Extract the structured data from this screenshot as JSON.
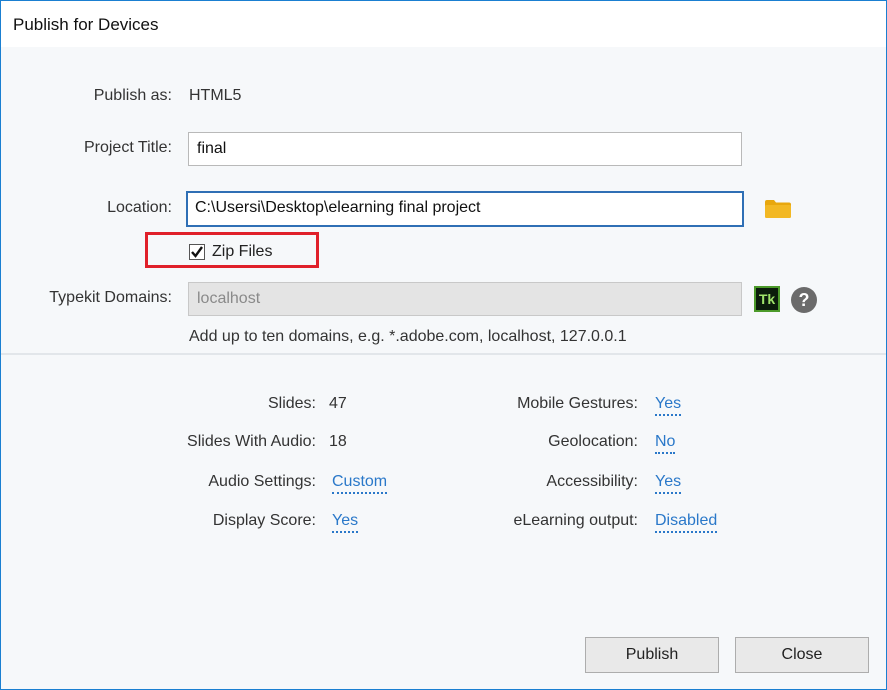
{
  "window": {
    "title": "Publish for Devices"
  },
  "publish_as": {
    "label": "Publish as:",
    "value": "HTML5"
  },
  "project_title": {
    "label": "Project Title:",
    "value": "final"
  },
  "location": {
    "label": "Location:",
    "value": "C:\\Usersi\\Desktop\\elearning final project",
    "folder_icon": "folder-icon"
  },
  "zip_files": {
    "label": "Zip Files",
    "checked": true
  },
  "typekit": {
    "label": "Typekit Domains:",
    "placeholder": "localhost",
    "tk_label": "Tk",
    "help_label": "?",
    "hint": "Add up to ten domains, e.g. *.adobe.com, localhost, 127.0.0.1"
  },
  "stats": {
    "slides": {
      "label": "Slides:",
      "value": "47"
    },
    "slides_with_audio": {
      "label": "Slides With Audio:",
      "value": "18"
    },
    "audio_settings": {
      "label": "Audio Settings:",
      "value": "Custom"
    },
    "display_score": {
      "label": "Display Score:",
      "value": "Yes"
    },
    "mobile_gestures": {
      "label": "Mobile Gestures:",
      "value": "Yes"
    },
    "geolocation": {
      "label": "Geolocation:",
      "value": "No"
    },
    "accessibility": {
      "label": "Accessibility:",
      "value": "Yes"
    },
    "elearning_output": {
      "label": "eLearning output:",
      "value": "Disabled"
    }
  },
  "buttons": {
    "publish": "Publish",
    "close": "Close"
  },
  "colors": {
    "accent": "#2a78c9",
    "highlight": "#e0202a",
    "folder": "#e8a70e"
  }
}
